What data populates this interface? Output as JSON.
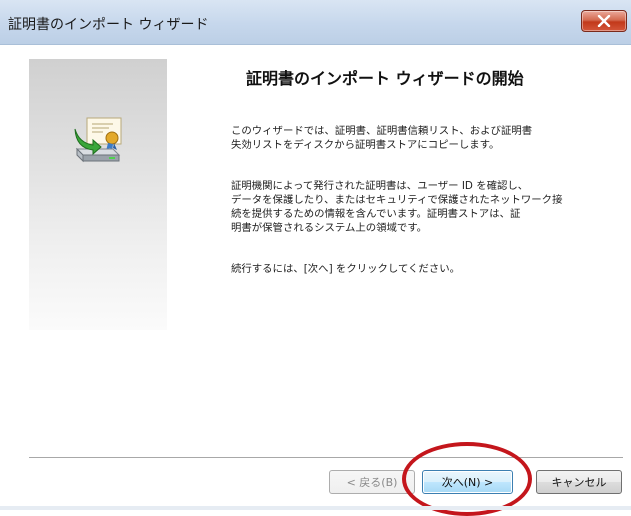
{
  "window": {
    "title": "証明書のインポート ウィザード",
    "close_label": "X"
  },
  "wizard": {
    "heading": "証明書のインポート ウィザードの開始",
    "paragraph1": [
      "このウィザードでは、証明書、証明書信頼リスト、および証明書",
      "失効リストをディスクから証明書ストアにコピーします。"
    ],
    "paragraph2": [
      "証明機関によって発行された証明書は、ユーザー ID を確認し、",
      "データを保護したり、またはセキュリティで保護されたネットワーク接",
      "続を提供するための情報を含んでいます。証明書ストアは、証",
      "明書が保管されるシステム上の領域です。"
    ],
    "paragraph3": "続行するには、[次へ] をクリックしてください。",
    "icon": "certificate-import-icon"
  },
  "buttons": {
    "back": "< 戻る(B)",
    "next": "次へ(N) >",
    "cancel": "キャンセル"
  },
  "colors": {
    "highlight_ring": "#c4161c",
    "close_button": "#c2391a"
  }
}
